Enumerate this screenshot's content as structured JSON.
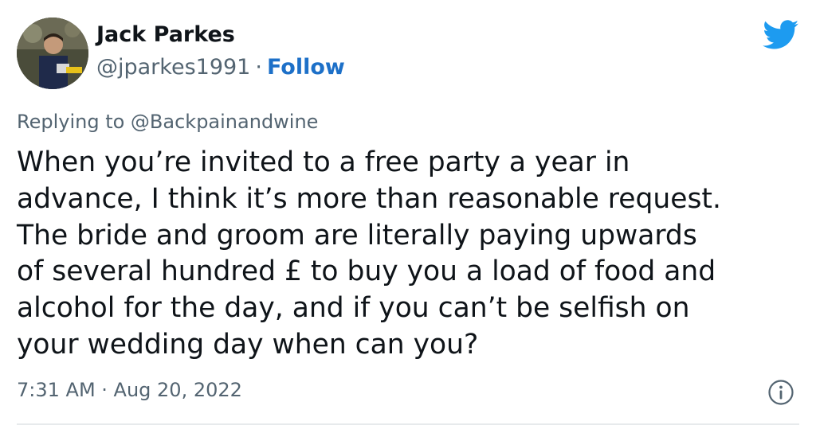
{
  "author": {
    "name": "Jack Parkes",
    "handle": "@jparkes1991",
    "separator": "·",
    "follow_label": "Follow"
  },
  "reply_context": "Replying to @Backpainandwine",
  "tweet_text": "When you’re invited to a free party a year in\nadvance, I think it’s more than reasonable request.\nThe bride and groom are literally paying upwards\nof several hundred £ to buy you a load of food and\nalcohol for the day, and if you can’t be selfish on\nyour wedding day when can you?",
  "timestamp": "7:31 AM · Aug 20, 2022",
  "icons": {
    "brand": "twitter-bird-icon",
    "info": "info-icon"
  },
  "colors": {
    "twitter_blue": "#1d9bf0",
    "follow_blue": "#1d70c8",
    "secondary_text": "#536471"
  }
}
